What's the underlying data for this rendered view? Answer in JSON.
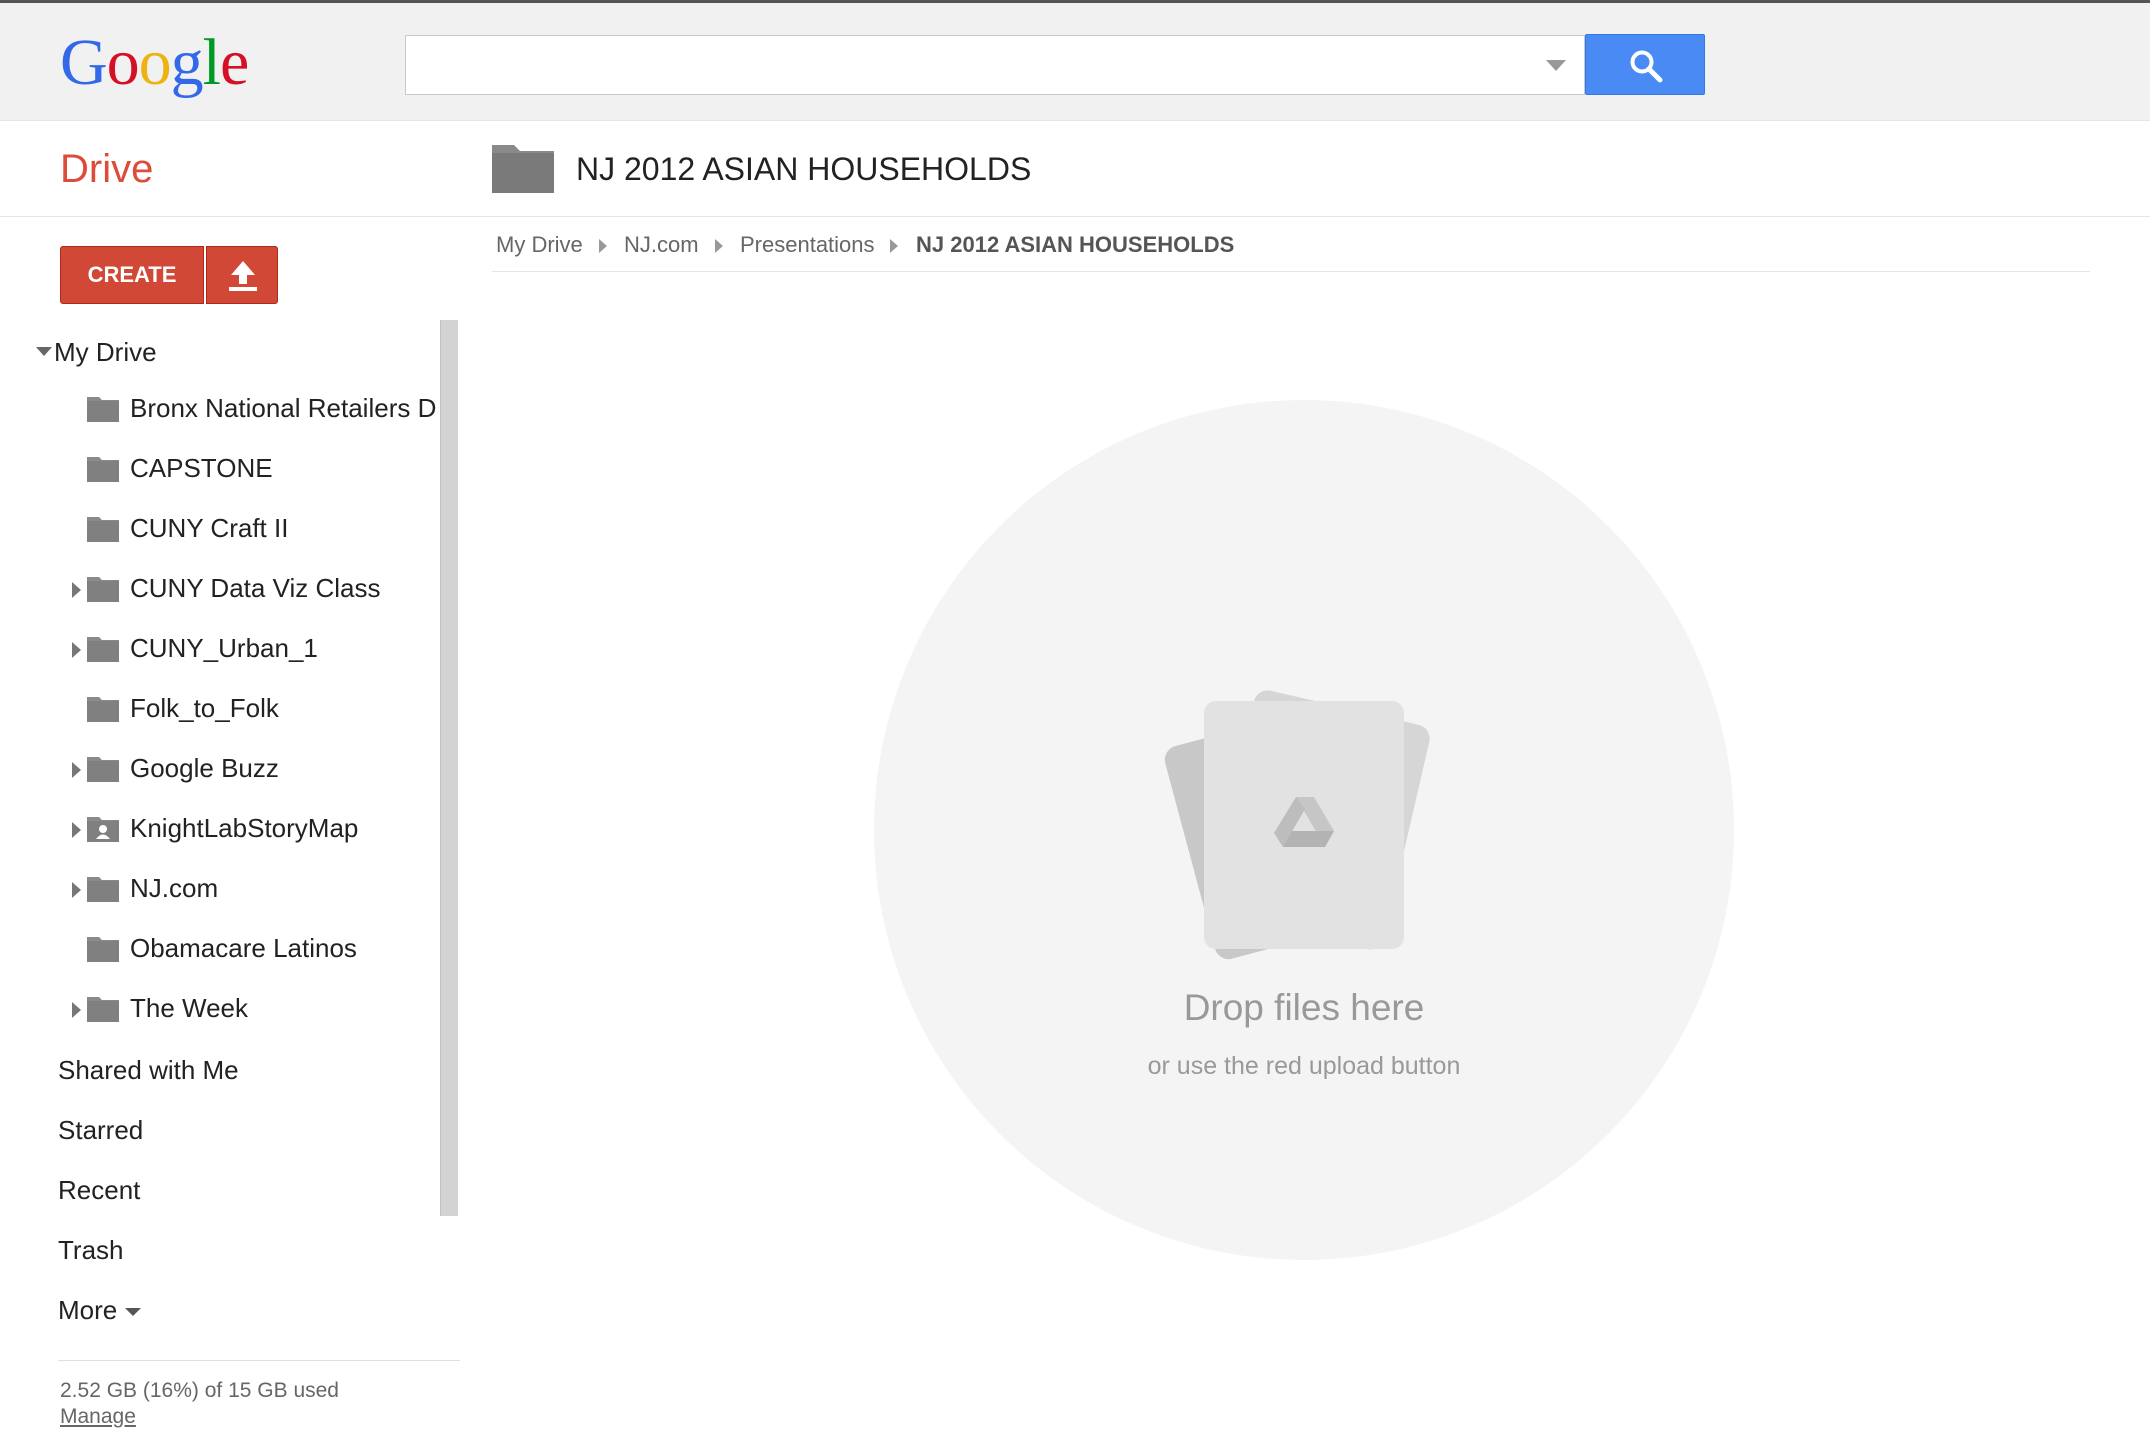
{
  "logo": {
    "letters": [
      {
        "char": "G",
        "color": "#3369e8"
      },
      {
        "char": "o",
        "color": "#d50f25"
      },
      {
        "char": "o",
        "color": "#eeb211"
      },
      {
        "char": "g",
        "color": "#3369e8"
      },
      {
        "char": "l",
        "color": "#009925"
      },
      {
        "char": "e",
        "color": "#d50f25"
      }
    ]
  },
  "search": {
    "value": "",
    "placeholder": "",
    "dropdown_icon": "chevron-down-icon",
    "button_icon": "search-icon",
    "button_color": "#4a8af4"
  },
  "app": {
    "title": "Drive",
    "title_color": "#dd4b39"
  },
  "folder": {
    "title": "NJ 2012 ASIAN HOUSEHOLDS",
    "icon": "folder-icon"
  },
  "actions": {
    "create_label": "CREATE",
    "upload_icon": "upload-icon",
    "accent_color": "#d14836"
  },
  "breadcrumb": [
    {
      "label": "My Drive"
    },
    {
      "label": "NJ.com"
    },
    {
      "label": "Presentations"
    },
    {
      "label": "NJ 2012 ASIAN HOUSEHOLDS",
      "current": true
    }
  ],
  "sidebar": {
    "root_label": "My Drive",
    "folders": [
      {
        "label": "Bronx National Retailers D",
        "expandable": false,
        "shared": false
      },
      {
        "label": "CAPSTONE",
        "expandable": false,
        "shared": false
      },
      {
        "label": "CUNY Craft II",
        "expandable": false,
        "shared": false
      },
      {
        "label": "CUNY Data Viz Class",
        "expandable": true,
        "shared": false
      },
      {
        "label": "CUNY_Urban_1",
        "expandable": true,
        "shared": false
      },
      {
        "label": "Folk_to_Folk",
        "expandable": false,
        "shared": false
      },
      {
        "label": "Google Buzz",
        "expandable": true,
        "shared": false
      },
      {
        "label": "KnightLabStoryMap",
        "expandable": true,
        "shared": true
      },
      {
        "label": "NJ.com",
        "expandable": true,
        "shared": false
      },
      {
        "label": "Obamacare Latinos",
        "expandable": false,
        "shared": false
      },
      {
        "label": "The Week",
        "expandable": true,
        "shared": false
      }
    ],
    "links": {
      "shared": "Shared with Me",
      "starred": "Starred",
      "recent": "Recent",
      "trash": "Trash",
      "more": "More"
    },
    "storage": "2.52 GB (16%) of 15 GB used",
    "manage": "Manage"
  },
  "dropzone": {
    "title": "Drop files here",
    "subtitle": "or use the red upload button",
    "icon": "drive-logo-icon"
  }
}
